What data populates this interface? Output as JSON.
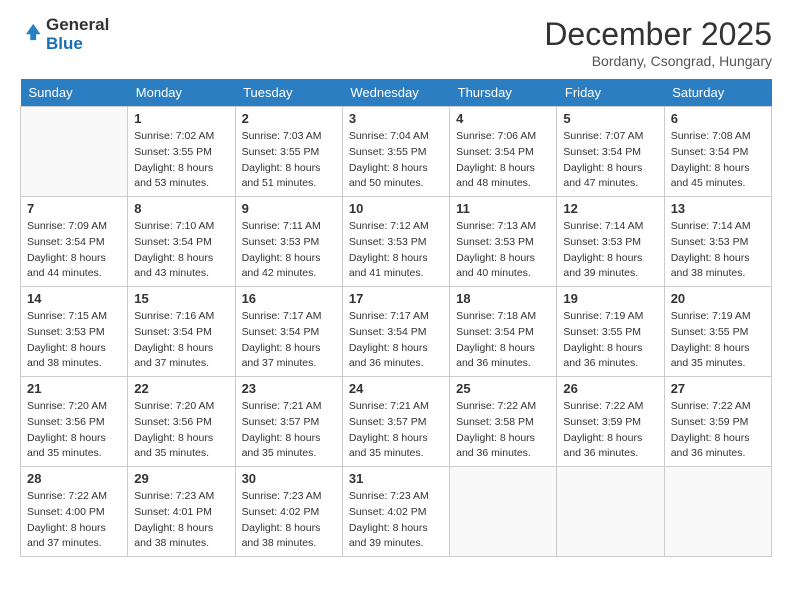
{
  "header": {
    "logo_general": "General",
    "logo_blue": "Blue",
    "month_title": "December 2025",
    "location": "Bordany, Csongrad, Hungary"
  },
  "days_of_week": [
    "Sunday",
    "Monday",
    "Tuesday",
    "Wednesday",
    "Thursday",
    "Friday",
    "Saturday"
  ],
  "weeks": [
    [
      {
        "day": "",
        "sunrise": "",
        "sunset": "",
        "daylight": ""
      },
      {
        "day": "1",
        "sunrise": "Sunrise: 7:02 AM",
        "sunset": "Sunset: 3:55 PM",
        "daylight": "Daylight: 8 hours and 53 minutes."
      },
      {
        "day": "2",
        "sunrise": "Sunrise: 7:03 AM",
        "sunset": "Sunset: 3:55 PM",
        "daylight": "Daylight: 8 hours and 51 minutes."
      },
      {
        "day": "3",
        "sunrise": "Sunrise: 7:04 AM",
        "sunset": "Sunset: 3:55 PM",
        "daylight": "Daylight: 8 hours and 50 minutes."
      },
      {
        "day": "4",
        "sunrise": "Sunrise: 7:06 AM",
        "sunset": "Sunset: 3:54 PM",
        "daylight": "Daylight: 8 hours and 48 minutes."
      },
      {
        "day": "5",
        "sunrise": "Sunrise: 7:07 AM",
        "sunset": "Sunset: 3:54 PM",
        "daylight": "Daylight: 8 hours and 47 minutes."
      },
      {
        "day": "6",
        "sunrise": "Sunrise: 7:08 AM",
        "sunset": "Sunset: 3:54 PM",
        "daylight": "Daylight: 8 hours and 45 minutes."
      }
    ],
    [
      {
        "day": "7",
        "sunrise": "Sunrise: 7:09 AM",
        "sunset": "Sunset: 3:54 PM",
        "daylight": "Daylight: 8 hours and 44 minutes."
      },
      {
        "day": "8",
        "sunrise": "Sunrise: 7:10 AM",
        "sunset": "Sunset: 3:54 PM",
        "daylight": "Daylight: 8 hours and 43 minutes."
      },
      {
        "day": "9",
        "sunrise": "Sunrise: 7:11 AM",
        "sunset": "Sunset: 3:53 PM",
        "daylight": "Daylight: 8 hours and 42 minutes."
      },
      {
        "day": "10",
        "sunrise": "Sunrise: 7:12 AM",
        "sunset": "Sunset: 3:53 PM",
        "daylight": "Daylight: 8 hours and 41 minutes."
      },
      {
        "day": "11",
        "sunrise": "Sunrise: 7:13 AM",
        "sunset": "Sunset: 3:53 PM",
        "daylight": "Daylight: 8 hours and 40 minutes."
      },
      {
        "day": "12",
        "sunrise": "Sunrise: 7:14 AM",
        "sunset": "Sunset: 3:53 PM",
        "daylight": "Daylight: 8 hours and 39 minutes."
      },
      {
        "day": "13",
        "sunrise": "Sunrise: 7:14 AM",
        "sunset": "Sunset: 3:53 PM",
        "daylight": "Daylight: 8 hours and 38 minutes."
      }
    ],
    [
      {
        "day": "14",
        "sunrise": "Sunrise: 7:15 AM",
        "sunset": "Sunset: 3:53 PM",
        "daylight": "Daylight: 8 hours and 38 minutes."
      },
      {
        "day": "15",
        "sunrise": "Sunrise: 7:16 AM",
        "sunset": "Sunset: 3:54 PM",
        "daylight": "Daylight: 8 hours and 37 minutes."
      },
      {
        "day": "16",
        "sunrise": "Sunrise: 7:17 AM",
        "sunset": "Sunset: 3:54 PM",
        "daylight": "Daylight: 8 hours and 37 minutes."
      },
      {
        "day": "17",
        "sunrise": "Sunrise: 7:17 AM",
        "sunset": "Sunset: 3:54 PM",
        "daylight": "Daylight: 8 hours and 36 minutes."
      },
      {
        "day": "18",
        "sunrise": "Sunrise: 7:18 AM",
        "sunset": "Sunset: 3:54 PM",
        "daylight": "Daylight: 8 hours and 36 minutes."
      },
      {
        "day": "19",
        "sunrise": "Sunrise: 7:19 AM",
        "sunset": "Sunset: 3:55 PM",
        "daylight": "Daylight: 8 hours and 36 minutes."
      },
      {
        "day": "20",
        "sunrise": "Sunrise: 7:19 AM",
        "sunset": "Sunset: 3:55 PM",
        "daylight": "Daylight: 8 hours and 35 minutes."
      }
    ],
    [
      {
        "day": "21",
        "sunrise": "Sunrise: 7:20 AM",
        "sunset": "Sunset: 3:56 PM",
        "daylight": "Daylight: 8 hours and 35 minutes."
      },
      {
        "day": "22",
        "sunrise": "Sunrise: 7:20 AM",
        "sunset": "Sunset: 3:56 PM",
        "daylight": "Daylight: 8 hours and 35 minutes."
      },
      {
        "day": "23",
        "sunrise": "Sunrise: 7:21 AM",
        "sunset": "Sunset: 3:57 PM",
        "daylight": "Daylight: 8 hours and 35 minutes."
      },
      {
        "day": "24",
        "sunrise": "Sunrise: 7:21 AM",
        "sunset": "Sunset: 3:57 PM",
        "daylight": "Daylight: 8 hours and 35 minutes."
      },
      {
        "day": "25",
        "sunrise": "Sunrise: 7:22 AM",
        "sunset": "Sunset: 3:58 PM",
        "daylight": "Daylight: 8 hours and 36 minutes."
      },
      {
        "day": "26",
        "sunrise": "Sunrise: 7:22 AM",
        "sunset": "Sunset: 3:59 PM",
        "daylight": "Daylight: 8 hours and 36 minutes."
      },
      {
        "day": "27",
        "sunrise": "Sunrise: 7:22 AM",
        "sunset": "Sunset: 3:59 PM",
        "daylight": "Daylight: 8 hours and 36 minutes."
      }
    ],
    [
      {
        "day": "28",
        "sunrise": "Sunrise: 7:22 AM",
        "sunset": "Sunset: 4:00 PM",
        "daylight": "Daylight: 8 hours and 37 minutes."
      },
      {
        "day": "29",
        "sunrise": "Sunrise: 7:23 AM",
        "sunset": "Sunset: 4:01 PM",
        "daylight": "Daylight: 8 hours and 38 minutes."
      },
      {
        "day": "30",
        "sunrise": "Sunrise: 7:23 AM",
        "sunset": "Sunset: 4:02 PM",
        "daylight": "Daylight: 8 hours and 38 minutes."
      },
      {
        "day": "31",
        "sunrise": "Sunrise: 7:23 AM",
        "sunset": "Sunset: 4:02 PM",
        "daylight": "Daylight: 8 hours and 39 minutes."
      },
      {
        "day": "",
        "sunrise": "",
        "sunset": "",
        "daylight": ""
      },
      {
        "day": "",
        "sunrise": "",
        "sunset": "",
        "daylight": ""
      },
      {
        "day": "",
        "sunrise": "",
        "sunset": "",
        "daylight": ""
      }
    ]
  ]
}
